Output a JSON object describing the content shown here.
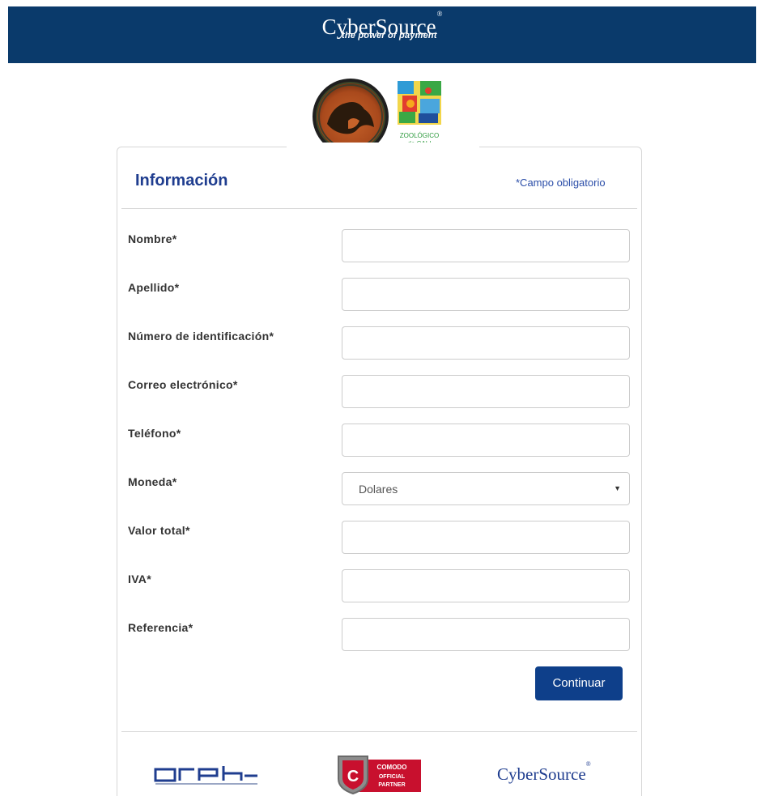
{
  "header": {
    "brand": "CyberSource",
    "brand_mark": "®",
    "tagline": "the power of payment",
    "bg_color": "#0a3a6b"
  },
  "logos": {
    "left_emblem_text": "ZOOLÓGICO",
    "zoo_line1": "ZOOLÓGICO",
    "zoo_line2": "de CALI"
  },
  "form": {
    "title": "Información",
    "required_note": "*Campo obligatorio",
    "fields": [
      {
        "label": "Nombre*",
        "value": ""
      },
      {
        "label": "Apellido*",
        "value": ""
      },
      {
        "label": "Número de identificación*",
        "value": ""
      },
      {
        "label": "Correo electrónico*",
        "value": ""
      },
      {
        "label": "Teléfono*",
        "value": ""
      },
      {
        "label": "Moneda*",
        "value": "Dolares"
      },
      {
        "label": "Valor total*",
        "value": ""
      },
      {
        "label": "IVA*",
        "value": ""
      },
      {
        "label": "Referencia*",
        "value": ""
      }
    ],
    "submit_label": "Continuar",
    "accent_color": "#0e3f8a"
  },
  "footer": {
    "comodo_line1": "COMODO",
    "comodo_line2": "OFFICIAL",
    "comodo_line3": "PARTNER",
    "cybersource": "CyberSource",
    "cybersource_mark": "®"
  }
}
